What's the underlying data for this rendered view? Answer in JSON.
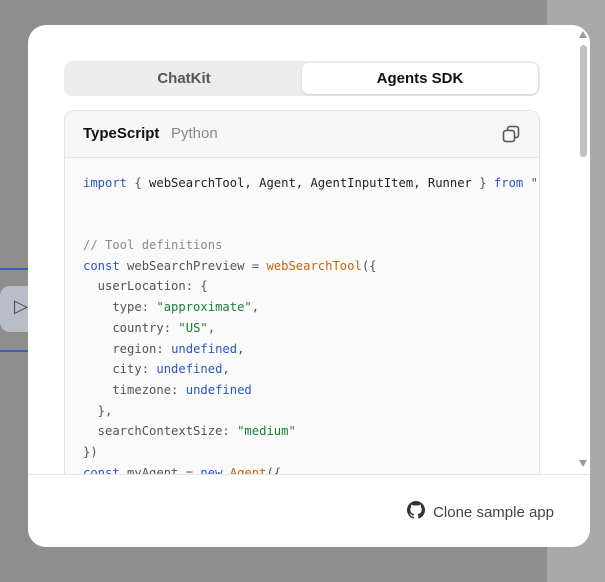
{
  "tabs": {
    "chatkit": "ChatKit",
    "agents_sdk": "Agents SDK"
  },
  "code": {
    "languages": {
      "typescript": "TypeScript",
      "python": "Python"
    },
    "lines": [
      [
        [
          "kw",
          "import"
        ],
        [
          "pun",
          " { "
        ],
        [
          "",
          "webSearchTool, Agent, AgentInputItem, Runner"
        ],
        [
          "pun",
          " } "
        ],
        [
          "kw",
          "from"
        ],
        [
          "str",
          " \""
        ]
      ],
      [],
      [],
      [
        [
          "cm",
          "// Tool definitions"
        ]
      ],
      [
        [
          "kw",
          "const"
        ],
        [
          "pun",
          " webSearchPreview = "
        ],
        [
          "fn",
          "webSearchTool"
        ],
        [
          "pun",
          "({"
        ]
      ],
      [
        [
          "pun",
          "  userLocation"
        ],
        [
          "pun",
          ": {"
        ]
      ],
      [
        [
          "pun",
          "    type: "
        ],
        [
          "str",
          "\"approximate\""
        ],
        [
          "pun",
          ","
        ]
      ],
      [
        [
          "pun",
          "    country: "
        ],
        [
          "str",
          "\"US\""
        ],
        [
          "pun",
          ","
        ]
      ],
      [
        [
          "pun",
          "    region: "
        ],
        [
          "kw",
          "undefined"
        ],
        [
          "pun",
          ","
        ]
      ],
      [
        [
          "pun",
          "    city: "
        ],
        [
          "kw",
          "undefined"
        ],
        [
          "pun",
          ","
        ]
      ],
      [
        [
          "pun",
          "    timezone: "
        ],
        [
          "kw",
          "undefined"
        ]
      ],
      [
        [
          "pun",
          "  },"
        ]
      ],
      [
        [
          "pun",
          "  searchContextSize: "
        ],
        [
          "str",
          "\"medium\""
        ]
      ],
      [
        [
          "pun",
          "})"
        ]
      ],
      [
        [
          "kw",
          "const"
        ],
        [
          "pun",
          " myAgent = "
        ],
        [
          "kw",
          "new"
        ],
        [
          "fn",
          " Agent"
        ],
        [
          "pun",
          "({"
        ]
      ]
    ]
  },
  "footer": {
    "clone_label": "Clone sample app"
  },
  "icons": {
    "copy": "copy-icon",
    "github": "github-icon",
    "cursor": "cursor-icon"
  }
}
